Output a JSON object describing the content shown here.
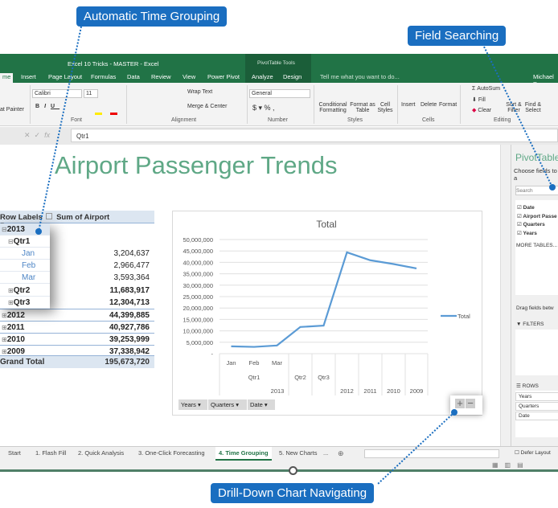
{
  "callouts": {
    "time_grouping": "Automatic Time Grouping",
    "field_search": "Field Searching",
    "drilldown": "Drill-Down Chart Navigating"
  },
  "window": {
    "title": "Excel 10 Tricks - MASTER - Excel",
    "context_tab_group": "PivotTable Tools",
    "user": "Michael P",
    "tell_me": "Tell me what you want to do..."
  },
  "tabs": [
    "me",
    "Insert",
    "Page Layout",
    "Formulas",
    "Data",
    "Review",
    "View",
    "Power Pivot",
    "Analyze",
    "Design"
  ],
  "ribbon": {
    "font_name": "Calibri",
    "font_size": "11",
    "format_painter": "at Painter",
    "wrap_text": "Wrap Text",
    "merge_center": "Merge & Center",
    "number_format": "General",
    "conditional_formatting": "Conditional Formatting",
    "format_as_table": "Format as Table",
    "cell_styles": "Cell Styles",
    "insert": "Insert",
    "delete": "Delete",
    "format": "Format",
    "autosum": "AutoSum",
    "fill": "Fill",
    "clear": "Clear",
    "sort_filter": "Sort & Filter",
    "find_select": "Find & Select",
    "groups": {
      "font": "Font",
      "alignment": "Alignment",
      "number": "Number",
      "styles": "Styles",
      "cells": "Cells",
      "editing": "Editing"
    }
  },
  "formula_bar": {
    "value": "Qtr1"
  },
  "sheet_title": "Airport Passenger Trends",
  "pivot": {
    "header_labels": "Row Labels",
    "header_values": "Sum of Airport Passengers",
    "rows": [
      {
        "label": "2013",
        "value": "",
        "level": 0,
        "sign": "⊟"
      },
      {
        "label": "Qtr1",
        "value": "",
        "level": 1,
        "sign": "⊟"
      },
      {
        "label": "Jan",
        "value": "3,204,637",
        "level": 2,
        "sign": ""
      },
      {
        "label": "Feb",
        "value": "2,966,477",
        "level": 2,
        "sign": ""
      },
      {
        "label": "Mar",
        "value": "3,593,364",
        "level": 2,
        "sign": ""
      },
      {
        "label": "Qtr2",
        "value": "11,683,917",
        "level": 1,
        "sign": "⊞"
      },
      {
        "label": "Qtr3",
        "value": "12,304,713",
        "level": 1,
        "sign": "⊞"
      },
      {
        "label": "2012",
        "value": "44,399,885",
        "level": 0,
        "sign": "⊞"
      },
      {
        "label": "2011",
        "value": "40,927,786",
        "level": 0,
        "sign": "⊞"
      },
      {
        "label": "2010",
        "value": "39,253,999",
        "level": 0,
        "sign": "⊞"
      },
      {
        "label": "2009",
        "value": "37,338,942",
        "level": 0,
        "sign": "⊞"
      }
    ],
    "grand_total_label": "Grand Total",
    "grand_total": "195,673,720"
  },
  "chart_data": {
    "type": "line",
    "title": "Total",
    "categories": [
      "Jan",
      "Feb",
      "Mar",
      "Qtr2",
      "Qtr3",
      "2012",
      "2011",
      "2010",
      "2009"
    ],
    "category_levels": {
      "quarters": [
        "Qtr1",
        "Qtr2",
        "Qtr3"
      ],
      "years": [
        "2013",
        "2012",
        "2011",
        "2010",
        "2009"
      ]
    },
    "series": [
      {
        "name": "Total",
        "values": [
          3204637,
          2966477,
          3593364,
          11683917,
          12304713,
          44399885,
          40927786,
          39253999,
          37338942
        ],
        "color": "#5b9bd5"
      }
    ],
    "ylim": [
      0,
      50000000
    ],
    "yticks": [
      "-",
      "5,000,000",
      "10,000,000",
      "15,000,000",
      "20,000,000",
      "25,000,000",
      "30,000,000",
      "35,000,000",
      "40,000,000",
      "45,000,000",
      "50,000,000"
    ],
    "grid": true,
    "legend": "right"
  },
  "chart_filters": [
    "Years",
    "Quarters",
    "Date"
  ],
  "field_pane": {
    "title": "PivotTable",
    "choose": "Choose fields to a",
    "search_placeholder": "Search",
    "fields": [
      "Date",
      "Airport Passe",
      "Quarters",
      "Years"
    ],
    "more_tables": "MORE TABLES...",
    "drag": "Drag fields betw",
    "filters": "FILTERS",
    "rows_label": "ROWS",
    "rows": [
      "Years",
      "Quarters",
      "Date"
    ],
    "defer": "Defer Layout"
  },
  "sheet_tabs": [
    "Start",
    "1. Flash Fill",
    "2. Quick Analysis",
    "3. One-Click Forecasting",
    "4. Time Grouping",
    "5. New Charts",
    "..."
  ],
  "active_sheet": "4. Time Grouping"
}
